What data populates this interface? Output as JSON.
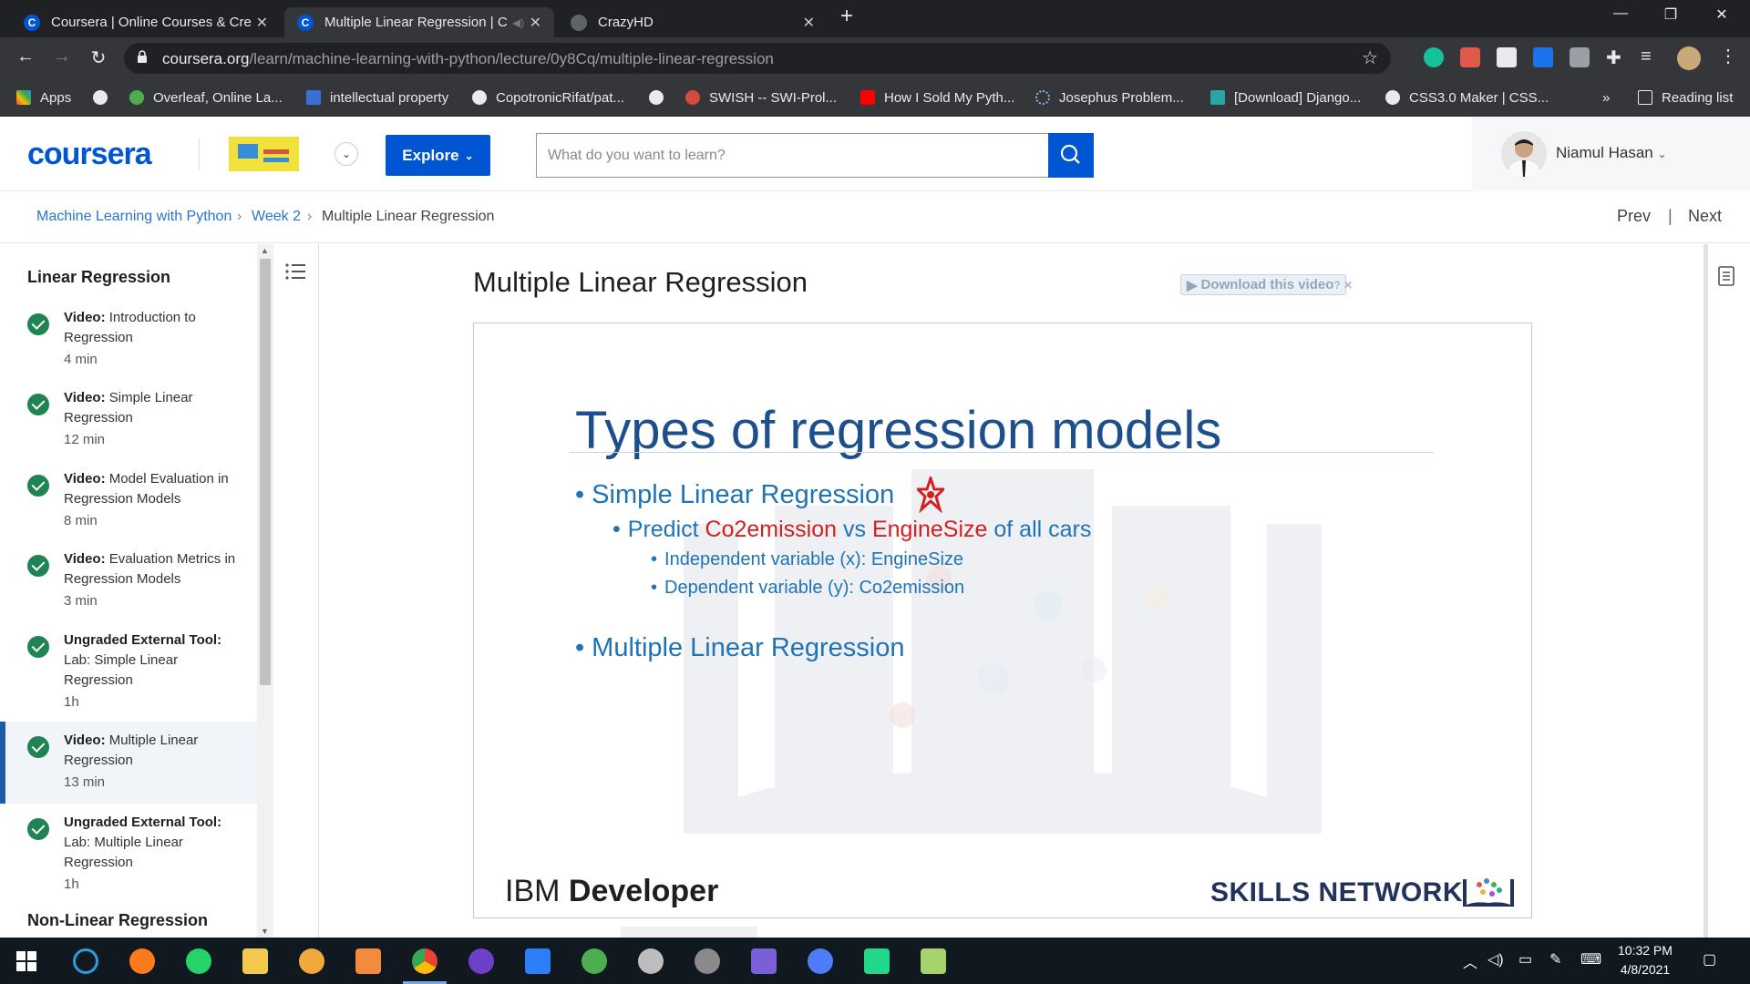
{
  "browser": {
    "tabs": [
      {
        "title": "Coursera | Online Courses & Cre",
        "active": false
      },
      {
        "title": "Multiple Linear Regression | C",
        "active": true
      },
      {
        "title": "CrazyHD",
        "active": false
      }
    ],
    "url_host": "coursera.org",
    "url_path": "/learn/machine-learning-with-python/lecture/0y8Cq/multiple-linear-regression",
    "bookmarks": [
      "Apps",
      "Overleaf, Online La...",
      "intellectual property",
      "CopotronicRifat/pat...",
      "SWISH -- SWI-Prol...",
      "How I Sold My Pyth...",
      "Josephus Problem...",
      "[Download] Django...",
      "CSS3.0 Maker | CSS...",
      "»",
      "Reading list"
    ]
  },
  "header": {
    "logo": "coursera",
    "explore_label": "Explore",
    "search_placeholder": "What do you want to learn?",
    "user_name": "Niamul Hasan"
  },
  "breadcrumb": {
    "course": "Machine Learning with Python",
    "week": "Week 2",
    "current": "Multiple Linear Regression",
    "sep": "›",
    "prev": "Prev",
    "divider": "|",
    "next": "Next"
  },
  "sidebar": {
    "section_title": "Linear Regression",
    "items": [
      {
        "type": "Video:",
        "title": "Introduction to Regression",
        "duration": "4 min"
      },
      {
        "type": "Video:",
        "title": "Simple Linear Regression",
        "duration": "12 min"
      },
      {
        "type": "Video:",
        "title": "Model Evaluation in Regression Models",
        "duration": "8 min"
      },
      {
        "type": "Video:",
        "title": "Evaluation Metrics in Regression Models",
        "duration": "3 min"
      },
      {
        "type": "Ungraded External Tool:",
        "title": "Lab: Simple Linear Regression",
        "duration": "1h"
      },
      {
        "type": "Video:",
        "title": "Multiple Linear Regression",
        "duration": "13 min"
      },
      {
        "type": "Ungraded External Tool:",
        "title": "Lab: Multiple Linear Regression",
        "duration": "1h"
      }
    ],
    "next_section": "Non-Linear Regression"
  },
  "main": {
    "lecture_title": "Multiple Linear Regression",
    "download_label": "Download this video",
    "slide": {
      "title": "Types of regression models",
      "bullet1": "Simple Linear Regression",
      "sub_a": "Predict ",
      "sub_b": "Co2emission",
      "sub_c": " vs ",
      "sub_d": "EngineSize",
      "sub_e": " of all cars",
      "sub3_1": "Independent variable (x): EngineSize",
      "sub3_2": "Dependent variable (y): Co2emission",
      "bullet2": "Multiple Linear Regression",
      "footer_left_a": "IBM ",
      "footer_left_b": "Developer",
      "footer_right": "SKILLS NETWORK"
    }
  },
  "taskbar": {
    "time": "10:32 PM",
    "date": "4/8/2021"
  },
  "colors": {
    "brand": "#0056d2",
    "check": "#1f8354",
    "slide_blue": "#1f73b7",
    "slide_red": "#d42020"
  }
}
